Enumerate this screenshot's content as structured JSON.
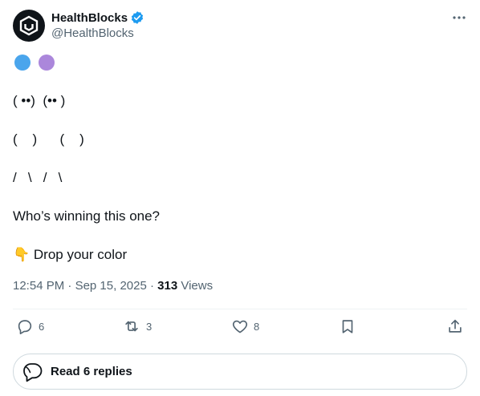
{
  "author": {
    "display_name": "HealthBlocks",
    "handle": "@HealthBlocks",
    "verified": true
  },
  "post": {
    "color_dots": [
      "#4aa5ec",
      "#ab87db"
    ],
    "lines": [
      "( ••)  (•• )",
      "(    )      (    )",
      "/   \\   /   \\",
      "Who’s winning this one?",
      "Drop your color"
    ],
    "emoji_point": "👇"
  },
  "meta": {
    "time": "12:54 PM",
    "date": "Sep 15, 2025",
    "separator": " · ",
    "views_count": "313",
    "views_label": "Views"
  },
  "actions": {
    "replies": "6",
    "reposts": "3",
    "likes": "8"
  },
  "read_replies": {
    "label": "Read 6 replies"
  },
  "colors": {
    "text": "#0f1419",
    "secondary": "#536471",
    "verified": "#1d9bf0",
    "border": "#cfd9de"
  }
}
